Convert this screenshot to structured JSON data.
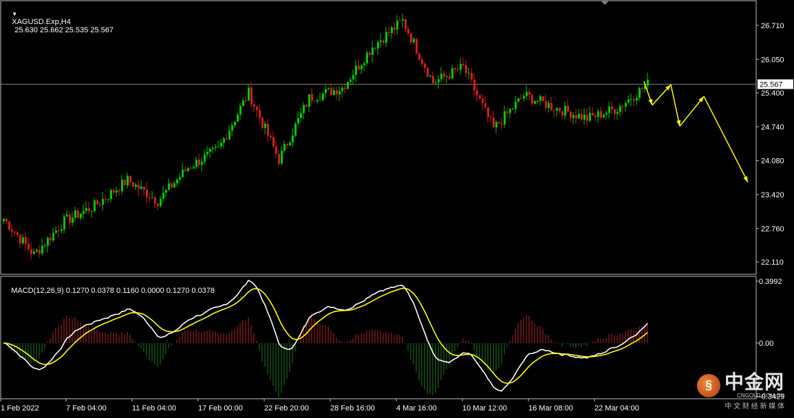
{
  "symbol_header": {
    "symbol": "XAGUSD.Exp,H4",
    "ohlc": "25.630 25.662 25.535 25.567"
  },
  "macd_header": {
    "text": "MACD(12,26,9) 0.1270 0.0378 0.1160 0.0000 0.1270 0.0378"
  },
  "price_axis": {
    "ticks": [
      "26.710",
      "26.050",
      "25.400",
      "24.740",
      "24.080",
      "23.420",
      "22.760",
      "22.110"
    ],
    "current_price": "25.567"
  },
  "macd_axis": {
    "ticks": [
      "0.3992",
      "0.00",
      "-0.3429"
    ]
  },
  "time_axis": {
    "labels": [
      "1 Feb 2022",
      "7 Feb 04:00",
      "11 Feb 04:00",
      "17 Feb 00:00",
      "22 Feb 20:00",
      "28 Feb 16:00",
      "4 Mar 16:00",
      "10 Mar 12:00",
      "16 Mar 08:00",
      "22 Mar 04:00"
    ]
  },
  "watermark": {
    "brand": "中金网",
    "tagline": "中 文 财 经 新 媒 体",
    "url": "CNGOLD.COM.CN"
  },
  "colors": {
    "bull": "#00c800",
    "bear": "#d21e1e",
    "macd_main": "#ffffff",
    "macd_signal": "#ffff00",
    "forecast": "#ffff00",
    "grid": "#808080"
  },
  "chart_data": [
    {
      "type": "candlestick",
      "title": "XAGUSD.Exp,H4",
      "y_range": [
        21.95,
        27.1
      ],
      "approx_close_path": [
        {
          "date": "1 Feb 2022",
          "price": 22.95
        },
        {
          "date": "4 Feb",
          "price": 22.25
        },
        {
          "date": "7 Feb 04:00",
          "price": 22.9
        },
        {
          "date": "10 Feb",
          "price": 23.2
        },
        {
          "date": "11 Feb 04:00",
          "price": 23.7
        },
        {
          "date": "14 Feb",
          "price": 23.3
        },
        {
          "date": "17 Feb 00:00",
          "price": 23.95
        },
        {
          "date": "21 Feb",
          "price": 24.3
        },
        {
          "date": "22 Feb 20:00",
          "price": 25.4
        },
        {
          "date": "23 Feb",
          "price": 24.1
        },
        {
          "date": "28 Feb 16:00",
          "price": 25.3
        },
        {
          "date": "3 Mar",
          "price": 25.5
        },
        {
          "date": "4 Mar 16:00",
          "price": 26.3
        },
        {
          "date": "7 Mar",
          "price": 26.8
        },
        {
          "date": "8 Mar",
          "price": 25.6
        },
        {
          "date": "10 Mar 12:00",
          "price": 25.9
        },
        {
          "date": "14 Mar",
          "price": 24.7
        },
        {
          "date": "16 Mar 08:00",
          "price": 25.35
        },
        {
          "date": "18 Mar",
          "price": 25.1
        },
        {
          "date": "21 Mar",
          "price": 24.9
        },
        {
          "date": "22 Mar 04:00",
          "price": 25.1
        },
        {
          "date": "24 Mar",
          "price": 25.567
        }
      ],
      "current_price": 25.567,
      "forecast_path": [
        25.62,
        25.16,
        25.56,
        24.75,
        25.33,
        23.66
      ]
    },
    {
      "type": "macd",
      "params": "MACD(12,26,9)",
      "values": [
        0.127,
        0.0378,
        0.116,
        0.0,
        0.127,
        0.0378
      ],
      "y_range": [
        -0.3429,
        0.3992
      ]
    }
  ]
}
